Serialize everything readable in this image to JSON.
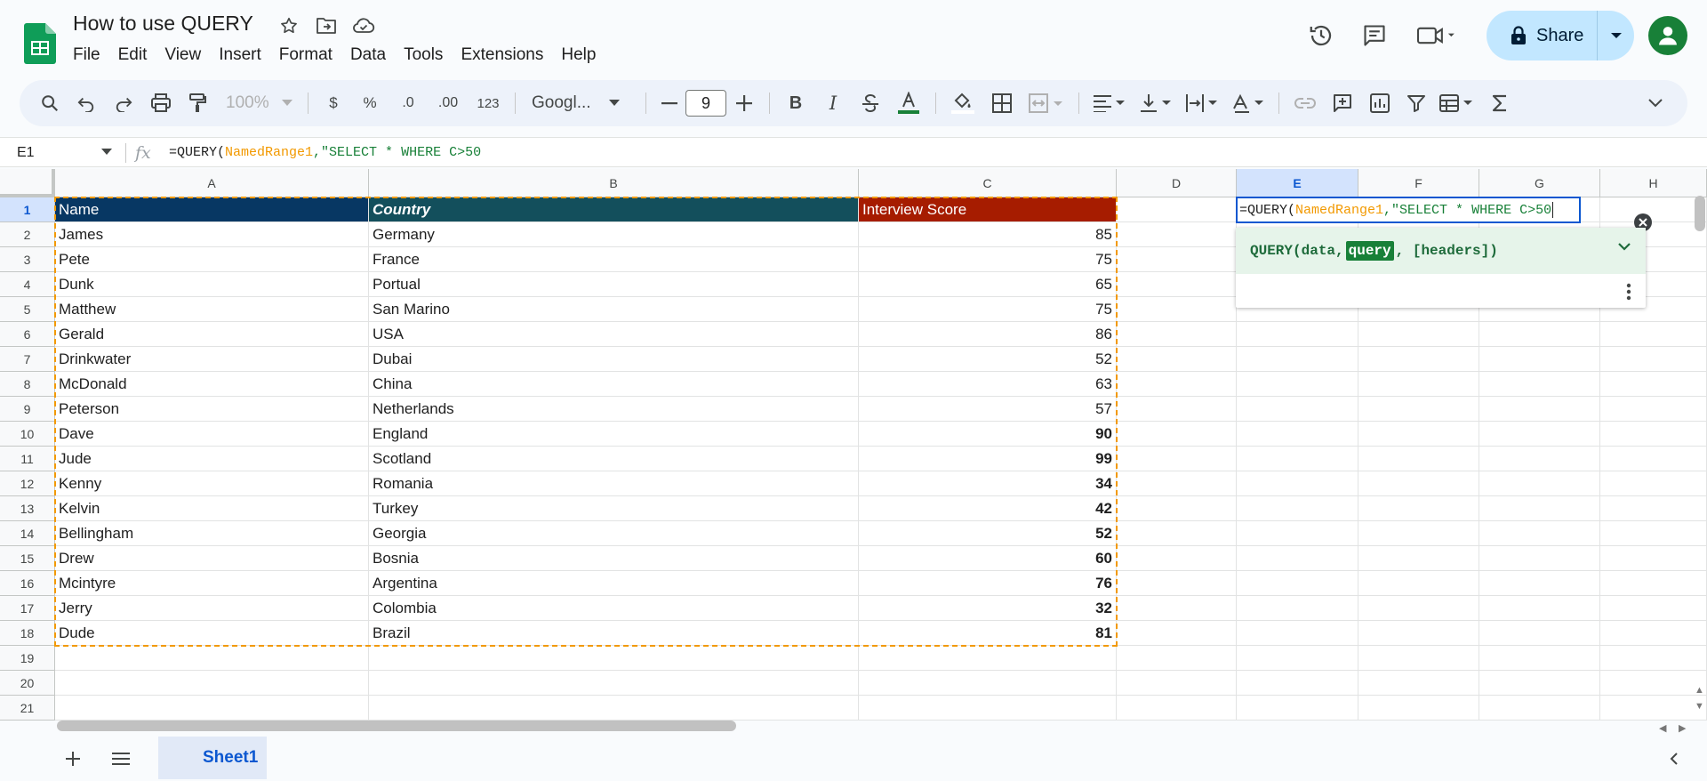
{
  "app": {
    "title": "How to use QUERY"
  },
  "menu": [
    "File",
    "Edit",
    "View",
    "Insert",
    "Format",
    "Data",
    "Tools",
    "Extensions",
    "Help"
  ],
  "header": {
    "share_label": "Share"
  },
  "toolbar": {
    "zoom": "100%",
    "currency": "$",
    "percent": "%",
    "dec_decrease": ".0",
    "dec_increase": ".00",
    "format_123": "123",
    "font": "Googl...",
    "font_size": "9"
  },
  "formula_bar": {
    "name_box": "E1",
    "formula_prefix": "=QUERY(",
    "formula_ref": "NamedRange1",
    "formula_str": ",\"SELECT * WHERE C>50"
  },
  "columns": [
    "A",
    "B",
    "C",
    "D",
    "E",
    "F",
    "G",
    "H"
  ],
  "rows": [
    "1",
    "2",
    "3",
    "4",
    "5",
    "6",
    "7",
    "8",
    "9",
    "10",
    "11",
    "12",
    "13",
    "14",
    "15",
    "16",
    "17",
    "18",
    "19",
    "20",
    "21"
  ],
  "table": {
    "headers": [
      "Name",
      "Country",
      "Interview Score"
    ],
    "records": [
      [
        "James",
        "Germany",
        "85"
      ],
      [
        "Pete",
        "France",
        "75"
      ],
      [
        "Dunk",
        "Portual",
        "65"
      ],
      [
        "Matthew",
        "San Marino",
        "75"
      ],
      [
        "Gerald",
        "USA",
        "86"
      ],
      [
        "Drinkwater",
        "Dubai",
        "52"
      ],
      [
        "McDonald",
        "China",
        "63"
      ],
      [
        "Peterson",
        "Netherlands",
        "57"
      ],
      [
        "Dave",
        "England",
        "90"
      ],
      [
        "Jude",
        "Scotland",
        "99"
      ],
      [
        "Kenny",
        "Romania",
        "34"
      ],
      [
        "Kelvin",
        "Turkey",
        "42"
      ],
      [
        "Bellingham",
        "Georgia",
        "52"
      ],
      [
        "Drew",
        "Bosnia",
        "60"
      ],
      [
        "Mcintyre",
        "Argentina",
        "76"
      ],
      [
        "Jerry",
        "Colombia",
        "32"
      ],
      [
        "Dude",
        "Brazil",
        "81"
      ]
    ]
  },
  "formula_helper": {
    "fn": "QUERY(data, ",
    "highlight": "query",
    "rest": ", [headers])"
  },
  "sheets": [
    {
      "name": "Sheet1"
    }
  ],
  "colors": {
    "accent": "#0b57d0",
    "share_bg": "#c2e7ff",
    "header_a": "#073763",
    "header_b": "#134f5c",
    "header_c": "#a61c00",
    "range_marquee": "#f29900"
  }
}
